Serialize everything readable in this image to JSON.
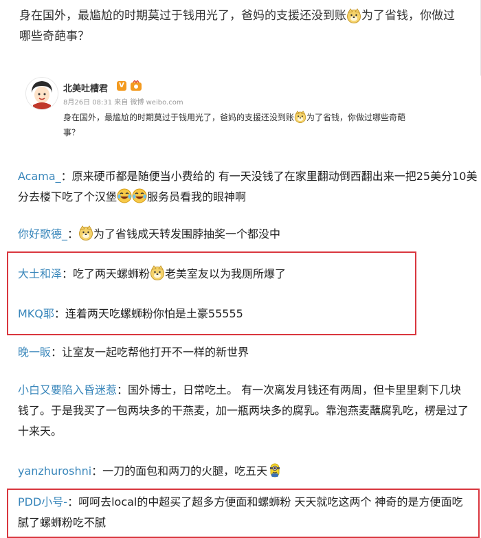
{
  "post": {
    "text_before": "身在国外，最尴尬的时期莫过于钱用光了，爸妈的支援还没到账",
    "text_after": "为了省钱，你做过哪些奇葩事？",
    "emoji": "doge-emoji"
  },
  "card": {
    "author": "北美吐槽君",
    "verified_badge": "V",
    "meta": "8月26日 08:31 来自 微博 weibo.com",
    "body_before": "身在国外，最尴尬的时期莫过于钱用光了，爸妈的支援还没到账",
    "body_after": "为了省钱，你做过哪些奇葩事？"
  },
  "comments": [
    {
      "user": "Acama_",
      "text": "：原来硬币都是随便当小费给的 有一天没钱了在家里翻动倒西翻出来一把25美分10美分去楼下吃了个汉堡",
      "text_after": "服务员看我的眼神啊",
      "emoji": "laugh-cry-emoji"
    },
    {
      "user": "你好歌德_",
      "sep": "：",
      "text": "为了省钱成天转发围脖抽奖一个都没中",
      "emoji": "doge-emoji"
    },
    {
      "user": "大土和泽",
      "text": "：吃了两天螺蛳粉",
      "text_after": "老美室友以为我厕所爆了",
      "emoji": "doge-emoji"
    },
    {
      "user": "MKQ耶",
      "text": "：连着两天吃螺蛳粉你怕是土豪55555"
    },
    {
      "user": "晚一眅",
      "text": "：让室友一起吃帮他打开不一样的新世界"
    },
    {
      "user": "小白又要陷入昏迷惹",
      "text": "：国外博士，日常吃土。 有一次离发月钱还有两周，但卡里里剩下几块钱了。于是我买了一包两块多的干燕麦，加一瓶两块多的腐乳。靠泡燕麦蘸腐乳吃，楞是过了十来天。"
    },
    {
      "user": "yanzhuroshni",
      "text": "：一刀的面包和两刀的火腿，吃五天",
      "emoji": "minion-emoji"
    },
    {
      "user": "PDD小号-",
      "text": "：呵呵去local的中超买了超多方便面和螺蛳粉 天天就吃这两个 神奇的是方便面吃腻了螺蛳粉吃不腻"
    }
  ]
}
